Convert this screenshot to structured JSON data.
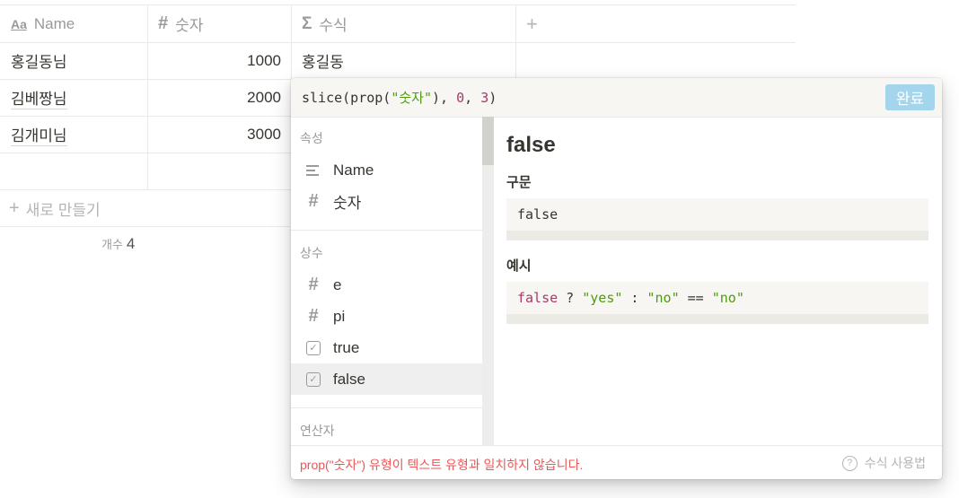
{
  "table": {
    "columns": [
      {
        "icon": "text-property-icon",
        "glyph": "Aa",
        "label": "Name"
      },
      {
        "icon": "number-property-icon",
        "glyph": "#",
        "label": "숫자"
      },
      {
        "icon": "formula-property-icon",
        "glyph": "Σ",
        "label": "수식"
      }
    ],
    "add_column_glyph": "+",
    "rows": [
      {
        "name": "홍길동님",
        "number": "1000",
        "formula": "홍길동"
      },
      {
        "name": "김베짱님",
        "number": "2000",
        "formula": ""
      },
      {
        "name": "김개미님",
        "number": "3000",
        "formula": ""
      },
      {
        "name": "",
        "number": "",
        "formula": ""
      }
    ],
    "new_row_label": "새로 만들기",
    "count_label": "개수",
    "count_value": "4"
  },
  "formula_popup": {
    "expression": {
      "p1": "slice(prop(",
      "s1": "\"숫자\"",
      "p2": "), ",
      "n1": "0",
      "p3": ", ",
      "n2": "3",
      "p4": ")"
    },
    "done_label": "완료",
    "sections": {
      "properties": {
        "title": "속성",
        "items": [
          {
            "label": "Name",
            "icon": "text-lines-icon"
          },
          {
            "label": "숫자",
            "icon": "hash-icon"
          }
        ]
      },
      "constants": {
        "title": "상수",
        "items": [
          {
            "label": "e",
            "icon": "hash-icon"
          },
          {
            "label": "pi",
            "icon": "hash-icon"
          },
          {
            "label": "true",
            "icon": "checkbox-icon"
          },
          {
            "label": "false",
            "icon": "checkbox-icon",
            "selected": true
          }
        ]
      },
      "operators": {
        "title": "연산자"
      }
    },
    "detail": {
      "title": "false",
      "syntax_label": "구문",
      "syntax_code": "false",
      "example_label": "예시",
      "example": {
        "kw": "false",
        "op1": " ? ",
        "s1": "\"yes\"",
        "op2": " : ",
        "s2": "\"no\"",
        "op3": " == ",
        "s3": "\"no\""
      }
    },
    "error_message": "prop(\"숫자\") 유형이 텍스트 유형과 일치하지 않습니다.",
    "help_label": "수식 사용법"
  }
}
